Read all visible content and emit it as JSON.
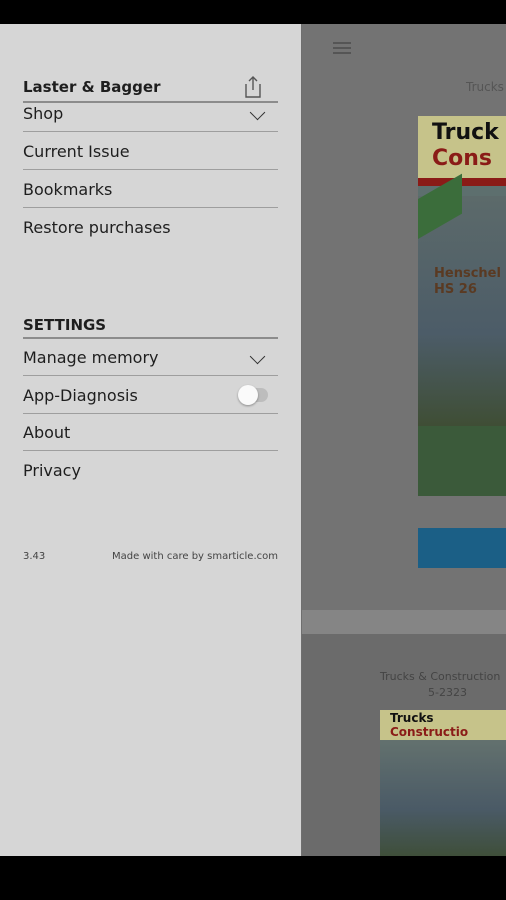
{
  "drawer": {
    "title": "Laster & Bagger",
    "menu": [
      {
        "label": "Shop"
      },
      {
        "label": "Current Issue"
      },
      {
        "label": "Bookmarks"
      },
      {
        "label": "Restore purchases"
      }
    ],
    "settings_heading": "SETTINGS",
    "settings": [
      {
        "label": "Manage memory"
      },
      {
        "label": "App-Diagnosis",
        "toggle_on": false
      },
      {
        "label": "About"
      },
      {
        "label": "Privacy"
      }
    ],
    "version": "3.43",
    "credit": "Made with care by smarticle.com"
  },
  "background": {
    "caption_top": "Trucks",
    "cover1": {
      "line1": "Truck",
      "line2": "Cons",
      "text1": "Henschel",
      "text2": "HS 26"
    },
    "caption2_line1": "Trucks & Construction",
    "caption2_line2": "5-2323",
    "cover2": {
      "line1": "Trucks",
      "line2": "Constructio"
    }
  },
  "colors": {
    "drawer_bg": "#d6d6d6",
    "scrim": "#6f6f6f",
    "accent_button": "#1b5f86"
  }
}
